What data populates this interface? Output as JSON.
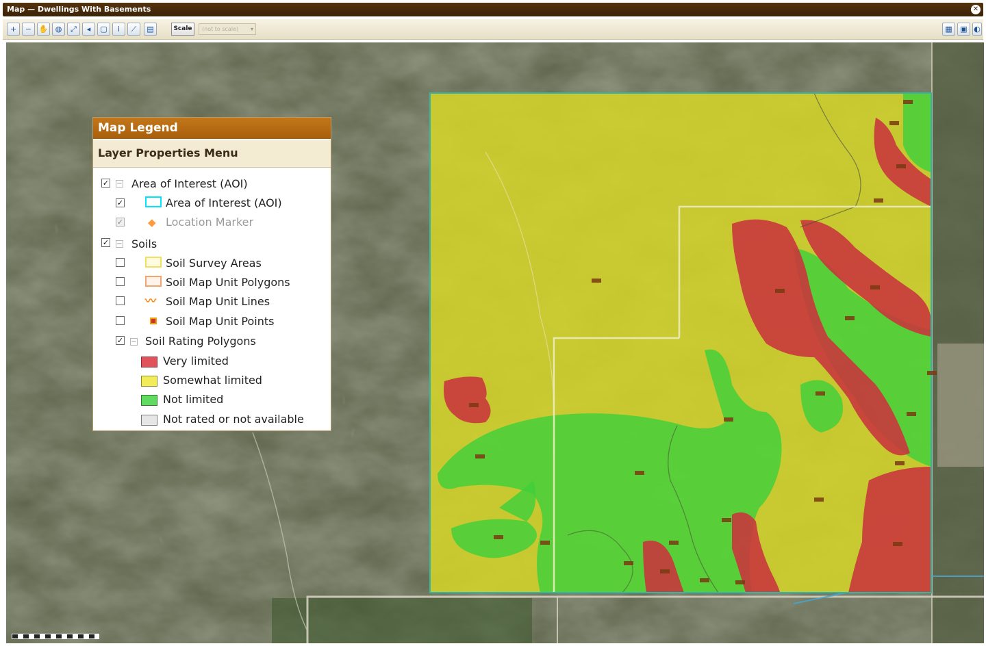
{
  "window": {
    "title": "Map — Dwellings With Basements"
  },
  "toolbar": {
    "tools": [
      "zoom-in-icon",
      "zoom-out-icon",
      "pan-icon",
      "globe-icon",
      "zoom-extent-icon",
      "back-icon",
      "select-icon",
      "info-icon",
      "measure-icon",
      "print-icon"
    ],
    "scale_label": "Scale",
    "scale_value": "(not to scale)"
  },
  "colors": {
    "title_bar": "#3b2408",
    "legend_header": "#b56a12",
    "very_limited": "#e0535b",
    "somewhat_limited": "#f2ec5a",
    "not_limited": "#5fdc5f",
    "not_rated": "#e6e6e6",
    "aoi_outline": "#00e5ff",
    "survey_area_outline": "#f0e060",
    "map_unit_polygon_outline": "#f5a36d",
    "map_unit_line": "#ff8c1a",
    "map_unit_point": "#c0392b",
    "location_marker": "#ff9a3c"
  },
  "legend": {
    "title": "Map Legend",
    "subtitle": "Layer Properties Menu",
    "aoi_group": "Area of Interest (AOI)",
    "aoi_layer": "Area of Interest (AOI)",
    "location_marker": "Location Marker",
    "soils_group": "Soils",
    "soil_survey_areas": "Soil Survey Areas",
    "soil_map_unit_polygons": "Soil Map Unit Polygons",
    "soil_map_unit_lines": "Soil Map Unit Lines",
    "soil_map_unit_points": "Soil Map Unit Points",
    "soil_rating_polygons": "Soil Rating Polygons",
    "ratings": {
      "very_limited": "Very limited",
      "somewhat_limited": "Somewhat limited",
      "not_limited": "Not limited",
      "not_rated": "Not rated or not available"
    }
  }
}
